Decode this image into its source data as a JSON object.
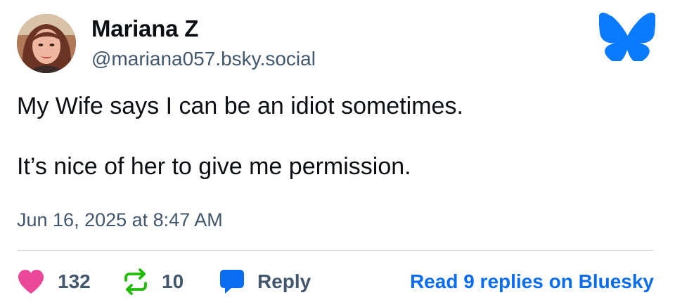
{
  "author": {
    "name": "Mariana Z",
    "handle": "@mariana057.bsky.social"
  },
  "post": {
    "lines": [
      "My Wife says I can be an idiot sometimes.",
      "It’s nice of her to give me permission."
    ],
    "timestamp": "Jun 16, 2025 at 8:47 AM"
  },
  "actions": {
    "likes": "132",
    "reposts": "10",
    "reply_label": "Reply",
    "read_more": "Read 9 replies on Bluesky"
  },
  "colors": {
    "like": "#ec4899",
    "repost": "#20bc07",
    "reply": "#0a6cf0",
    "link": "#0a6cf0",
    "muted": "#42576c",
    "bluesky": "#0a7aff"
  },
  "icons": {
    "avatar": "avatar",
    "logo": "bluesky-butterfly-icon",
    "like": "heart-icon",
    "repost": "repost-icon",
    "reply": "speech-bubble-icon"
  }
}
